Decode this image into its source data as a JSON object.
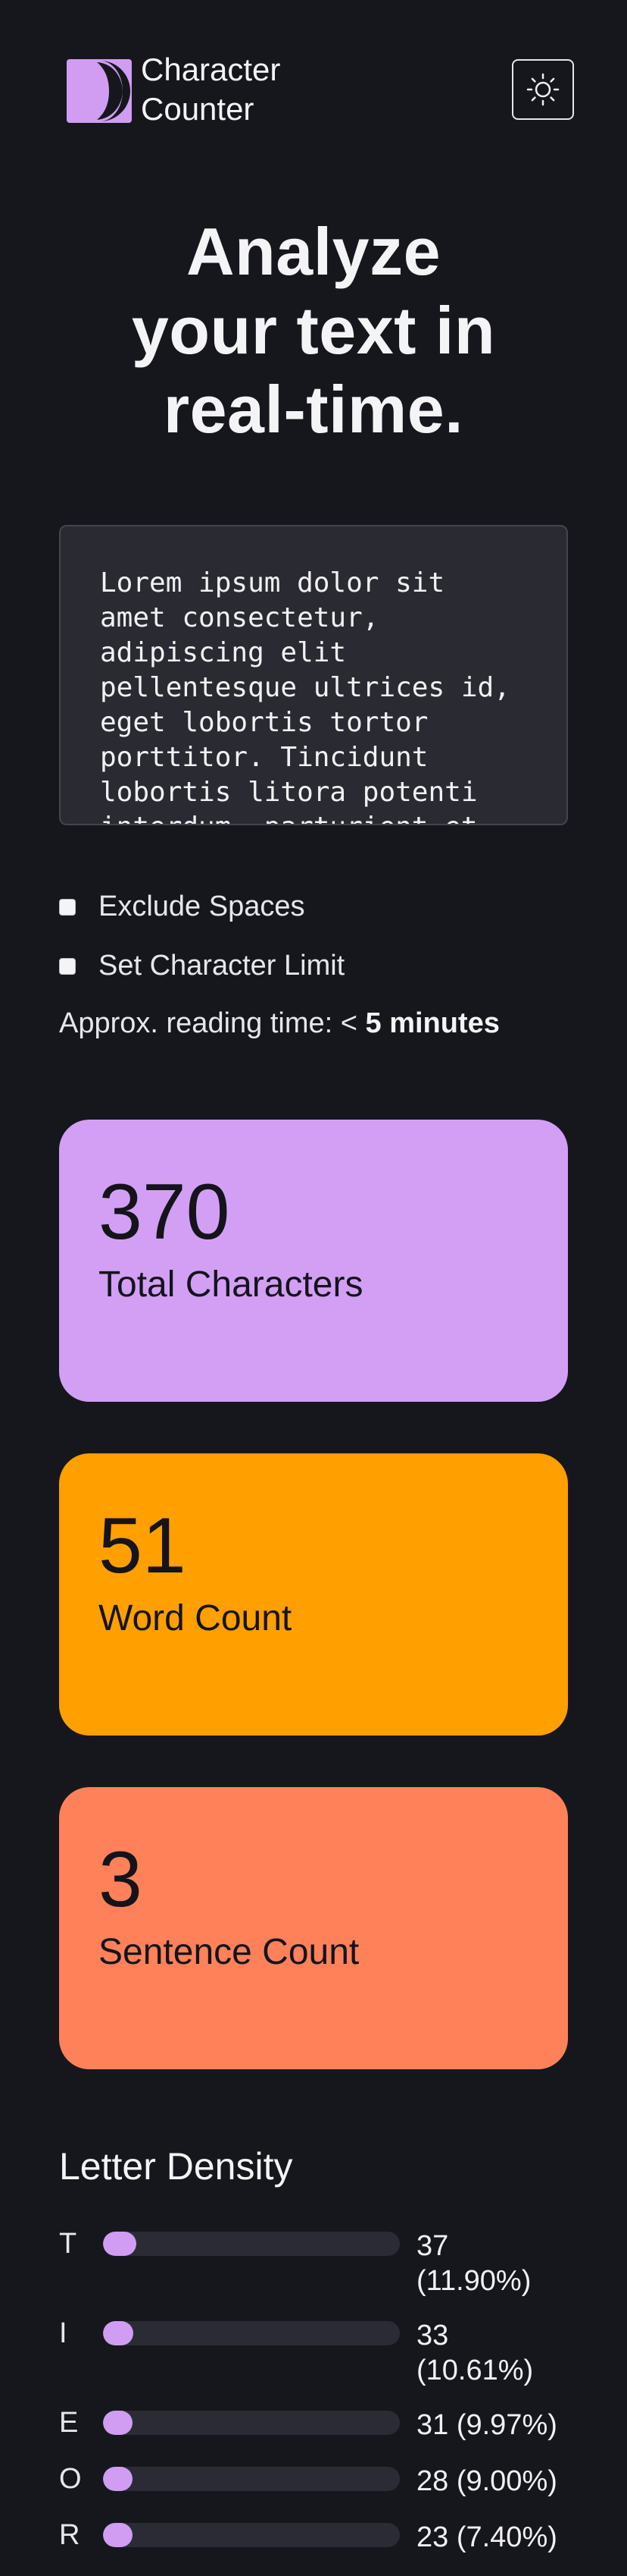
{
  "header": {
    "brand_line1": "Character",
    "brand_line2": "Counter",
    "logo_icon": "half-circle-logo-icon",
    "theme_icon": "sun-icon",
    "accent_color": "#d09df3"
  },
  "hero": {
    "line1": "Analyze",
    "line2": "your text in",
    "line3": "real-time."
  },
  "editor": {
    "value": "Lorem ipsum dolor sit\namet consectetur,\nadipiscing elit\npellentesque ultrices id,\neget lobortis tortor\nporttitor. Tincidunt\nlobortis litora potenti\ninterdum, parturient et"
  },
  "options": {
    "exclude_spaces": "Exclude Spaces",
    "set_limit": "Set Character Limit",
    "reading_prefix": "Approx. reading time: < ",
    "reading_value": "5 minutes"
  },
  "stats": [
    {
      "value": "370",
      "label": "Total Characters",
      "color": "#d39ff5"
    },
    {
      "value": "51",
      "label": "Word Count",
      "color": "#ff9f00"
    },
    {
      "value": "3",
      "label": "Sentence Count",
      "color": "#fe8159"
    }
  ],
  "density": {
    "title": "Letter Density",
    "rows": [
      {
        "letter": "T",
        "count_line1": "37",
        "count_line2": "(11.90%)",
        "share": 0.119
      },
      {
        "letter": "I",
        "count_line1": "33",
        "count_line2": "(10.61%)",
        "share": 0.1061
      },
      {
        "letter": "E",
        "count_line1": "31 (9.97%)",
        "count_line2": "",
        "share": 0.0997
      },
      {
        "letter": "O",
        "count_line1": "28 (9.00%)",
        "count_line2": "",
        "share": 0.09
      },
      {
        "letter": "R",
        "count_line1": "23 (7.40%)",
        "count_line2": "",
        "share": 0.074
      }
    ]
  }
}
